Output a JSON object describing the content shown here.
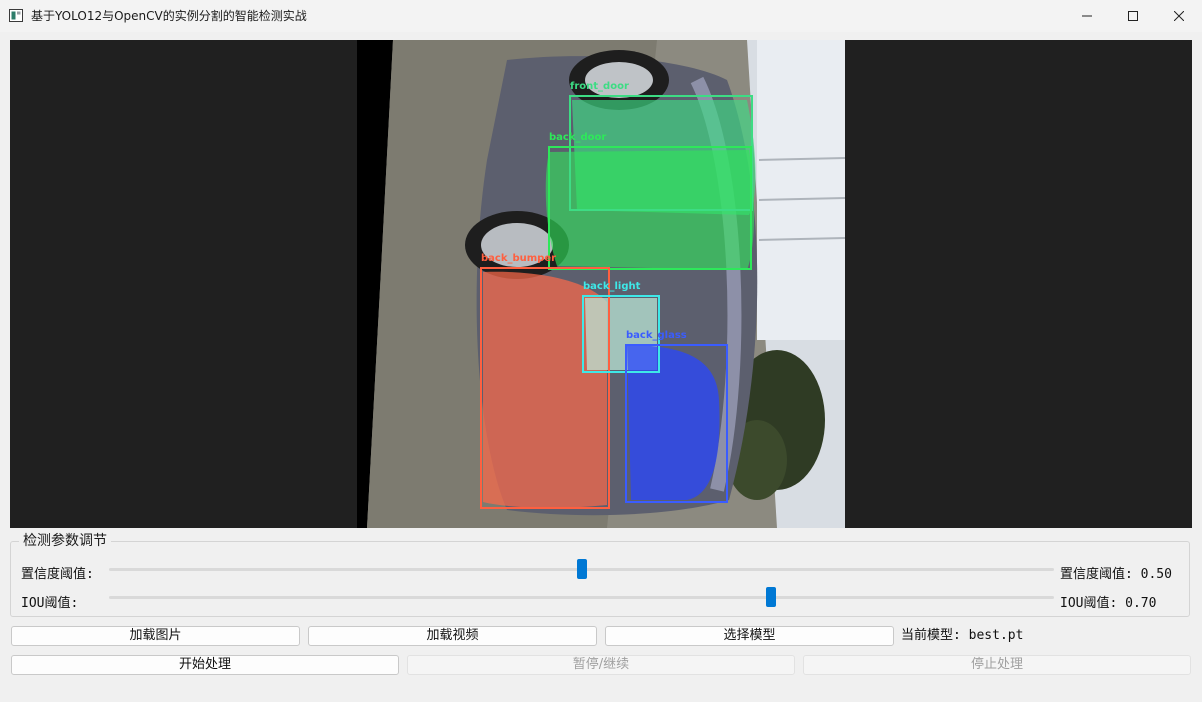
{
  "window": {
    "title": "基于YOLO12与OpenCV的实例分割的智能检测实战"
  },
  "detections": [
    {
      "label": "front_door",
      "color": "#3ddc84"
    },
    {
      "label": "back_door",
      "color": "#2ee85a"
    },
    {
      "label": "back_bumper",
      "color": "#ff6040"
    },
    {
      "label": "back_light",
      "color": "#3ee8e8"
    },
    {
      "label": "back_glass",
      "color": "#3a5cff"
    }
  ],
  "params": {
    "group_title": "检测参数调节",
    "confidence": {
      "label": "置信度阈值:",
      "value_text": "置信度阈值: 0.50",
      "value": 0.5
    },
    "iou": {
      "label": "IOU阈值:",
      "value_text": "IOU阈值: 0.70",
      "value": 0.7
    }
  },
  "buttons": {
    "load_image": "加载图片",
    "load_video": "加载视频",
    "select_model": "选择模型",
    "start": "开始处理",
    "pause": "暂停/继续",
    "stop": "停止处理"
  },
  "model": {
    "current_text": "当前模型: best.pt"
  },
  "colors": {
    "accent": "#0078d4",
    "viewport_bg": "#202020"
  }
}
